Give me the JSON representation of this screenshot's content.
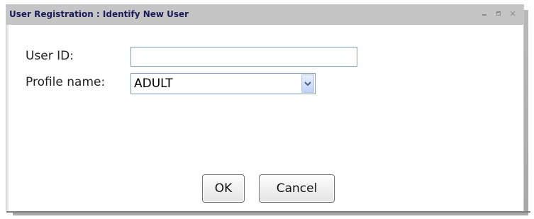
{
  "window": {
    "title": "User Registration : Identify New User",
    "controls": {
      "minimize_icon": "minimize-icon",
      "maximize_icon": "maximize-icon",
      "close_glyph": "×"
    }
  },
  "form": {
    "user_id": {
      "label": "User ID:",
      "value": "",
      "placeholder": ""
    },
    "profile_name": {
      "label": "Profile name:",
      "selected": "ADULT"
    }
  },
  "buttons": {
    "ok_label": "OK",
    "cancel_label": "Cancel"
  },
  "colors": {
    "titlebar": "#c5c5c5",
    "title_text": "#1b1b5a",
    "input_border": "#7f9db9",
    "dropdown_arrow": "#4d6185"
  }
}
